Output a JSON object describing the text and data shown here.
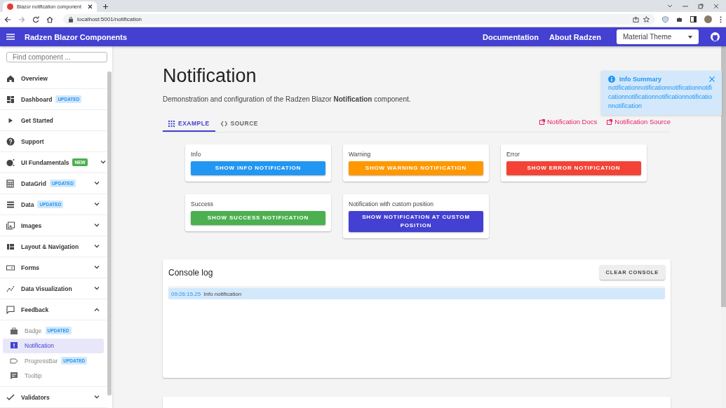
{
  "browser": {
    "tab_title": "Blazor notification component",
    "url": "localhost:5001/notification"
  },
  "header": {
    "title": "Radzen Blazor Components",
    "links": [
      "Documentation",
      "About Radzen"
    ],
    "theme_select": {
      "value": "Material Theme"
    }
  },
  "sidebar": {
    "search": {
      "placeholder": "Find component ..."
    },
    "items": [
      {
        "label": "Overview",
        "selected": false
      },
      {
        "label": "Dashboard",
        "badge": {
          "text": "UPDATED",
          "kind": "updated"
        },
        "selected": false
      },
      {
        "label": "Get Started",
        "selected": false
      },
      {
        "label": "Support",
        "selected": false
      },
      {
        "label": "UI Fundamentals",
        "badge": {
          "text": "NEW",
          "kind": "new"
        },
        "expanded": false,
        "selected": false
      },
      {
        "label": "DataGrid",
        "badge": {
          "text": "UPDATED",
          "kind": "updated"
        },
        "expanded": false,
        "selected": false
      },
      {
        "label": "Data",
        "badge": {
          "text": "UPDATED",
          "kind": "updated"
        },
        "expanded": false,
        "selected": false
      },
      {
        "label": "Images",
        "expanded": false,
        "selected": false
      },
      {
        "label": "Layout & Navigation",
        "expanded": false,
        "selected": false
      },
      {
        "label": "Forms",
        "expanded": false,
        "selected": false
      },
      {
        "label": "Data Visualization",
        "expanded": false,
        "selected": false
      },
      {
        "label": "Feedback",
        "expanded": true,
        "selected": false,
        "children": [
          {
            "label": "Badge",
            "badge": {
              "text": "UPDATED",
              "kind": "updated"
            },
            "selected": false
          },
          {
            "label": "Notification",
            "selected": true
          },
          {
            "label": "ProgressBar",
            "badge": {
              "text": "UPDATED",
              "kind": "updated"
            },
            "selected": false
          },
          {
            "label": "Tooltip",
            "selected": false
          }
        ]
      },
      {
        "label": "Validators",
        "expanded": false,
        "selected": false
      }
    ]
  },
  "page": {
    "title": "Notification",
    "description": "Demonstration and configuration of the Radzen Blazor **Notification** component.",
    "tabs": [
      {
        "label": "EXAMPLE",
        "selected": true
      },
      {
        "label": "SOURCE",
        "selected": false
      }
    ],
    "links": [
      "Notification Docs",
      "Notification Source"
    ],
    "cards": [
      {
        "label": "Info",
        "button": "SHOW INFO NOTIFICATION",
        "color": "#2196f3"
      },
      {
        "label": "Warning",
        "button": "SHOW WARNING NOTIFICATION",
        "color": "#ff9800"
      },
      {
        "label": "Error",
        "button": "SHOW ERROR NOTIFICATION",
        "color": "#f44336"
      },
      {
        "label": "Success",
        "button": "SHOW SUCCESS NOTIFICATION",
        "color": "#4caf50"
      },
      {
        "label": "Notification with custom position",
        "button": "SHOW NOTIFICATION AT CUSTOM POSITION",
        "color": "#4340d2"
      }
    ]
  },
  "console": {
    "title": "Console log",
    "clear_button": "CLEAR CONSOLE",
    "entries": [
      {
        "time": "09:26:15.25",
        "message": "Info notification"
      }
    ]
  },
  "toast": {
    "kind": "info",
    "title": "Info Summary",
    "message": "notificationnotificationnotificationnotificationnotificationnotificationnotificationnotification"
  }
}
